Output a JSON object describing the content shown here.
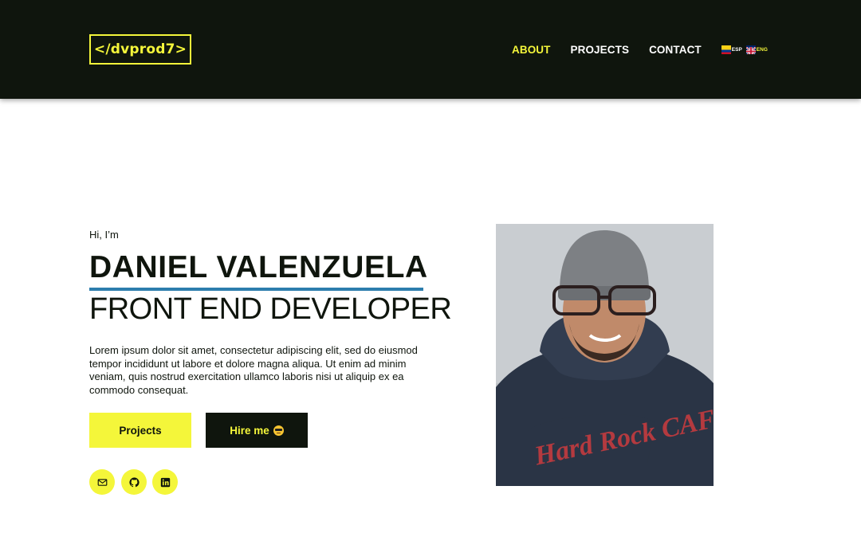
{
  "nav": {
    "logo": "</dvprod7>",
    "links": [
      {
        "label": "ABOUT",
        "active": true
      },
      {
        "label": "PROJECTS",
        "active": false
      },
      {
        "label": "CONTACT",
        "active": false
      }
    ],
    "languages": [
      {
        "flag": "colombia-flag-icon",
        "label": "ESP",
        "active": false
      },
      {
        "flag": "uk-flag-icon",
        "label": "ENG",
        "active": true
      }
    ]
  },
  "hero": {
    "greeting": "Hi, I’m",
    "name": "DANIEL VALENZUELA",
    "role": "FRONT END DEVELOPER",
    "bio": "Lorem ipsum dolor sit amet, consectetur adipiscing elit, sed do eiusmod tempor incididunt ut labore et dolore magna aliqua. Ut enim ad minim veniam, quis nostrud exercitation ullamco laboris nisi ut aliquip ex ea commodo consequat.",
    "buttons": {
      "projects": "Projects",
      "hire": "Hire me"
    },
    "social": [
      "mail-icon",
      "github-icon",
      "linkedin-icon"
    ],
    "photo_shirt_text": "Hard Rock CAFE"
  },
  "colors": {
    "dark": "#0f150d",
    "accent": "#f4f63a",
    "underline": "#2c7dad",
    "white": "#ffffff"
  }
}
